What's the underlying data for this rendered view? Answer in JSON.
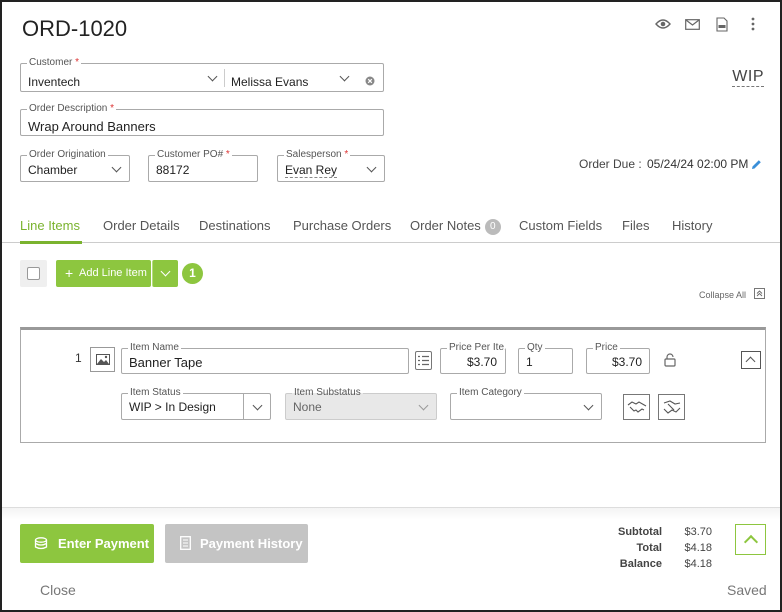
{
  "order": {
    "title": "ORD-1020",
    "status": "WIP",
    "due_label": "Order Due :",
    "due_value": "05/24/24 02:00 PM"
  },
  "header_icons": [
    "eye-icon",
    "mail-icon",
    "pdf-icon",
    "more-vertical-icon"
  ],
  "form": {
    "customer_label": "Customer",
    "customer_value": "Inventech",
    "contact_value": "Melissa Evans",
    "description_label": "Order Description",
    "description_value": "Wrap Around Banners",
    "origination_label": "Order Origination",
    "origination_value": "Chamber",
    "po_label": "Customer PO#",
    "po_value": "88172",
    "salesperson_label": "Salesperson",
    "salesperson_value": "Evan Rey",
    "required_mark": "*"
  },
  "tabs": [
    {
      "label": "Line Items",
      "active": true
    },
    {
      "label": "Order Details"
    },
    {
      "label": "Destinations"
    },
    {
      "label": "Purchase Orders"
    },
    {
      "label": "Order Notes",
      "badge": "0"
    },
    {
      "label": "Custom Fields"
    },
    {
      "label": "Files"
    },
    {
      "label": "History"
    }
  ],
  "toolbar": {
    "add_line_item_label": "Add Line Item",
    "count_badge": "1",
    "collapse_all_label": "Collapse All"
  },
  "line_item": {
    "index": "1",
    "name_label": "Item Name",
    "name_value": "Banner Tape",
    "price_per_label": "Price Per Ite...",
    "price_per_value": "$3.70",
    "qty_label": "Qty",
    "qty_value": "1",
    "price_label": "Price",
    "price_value": "$3.70",
    "status_label": "Item Status",
    "status_value": "WIP > In Design",
    "substatus_label": "Item Substatus",
    "substatus_value": "None",
    "category_label": "Item Category",
    "category_value": ""
  },
  "footer": {
    "enter_payment_label": "Enter Payment",
    "payment_history_label": "Payment History",
    "close_label": "Close",
    "saved_label": "Saved",
    "subtotal_label": "Subtotal",
    "subtotal_value": "$3.70",
    "total_label": "Total",
    "total_value": "$4.18",
    "balance_label": "Balance",
    "balance_value": "$4.18"
  },
  "colors": {
    "accent": "#8dc63f",
    "tab_active": "#7ab32e",
    "required": "#dd3333",
    "disabled": "#c4c4c4",
    "edit_icon": "#3a8fd8"
  }
}
